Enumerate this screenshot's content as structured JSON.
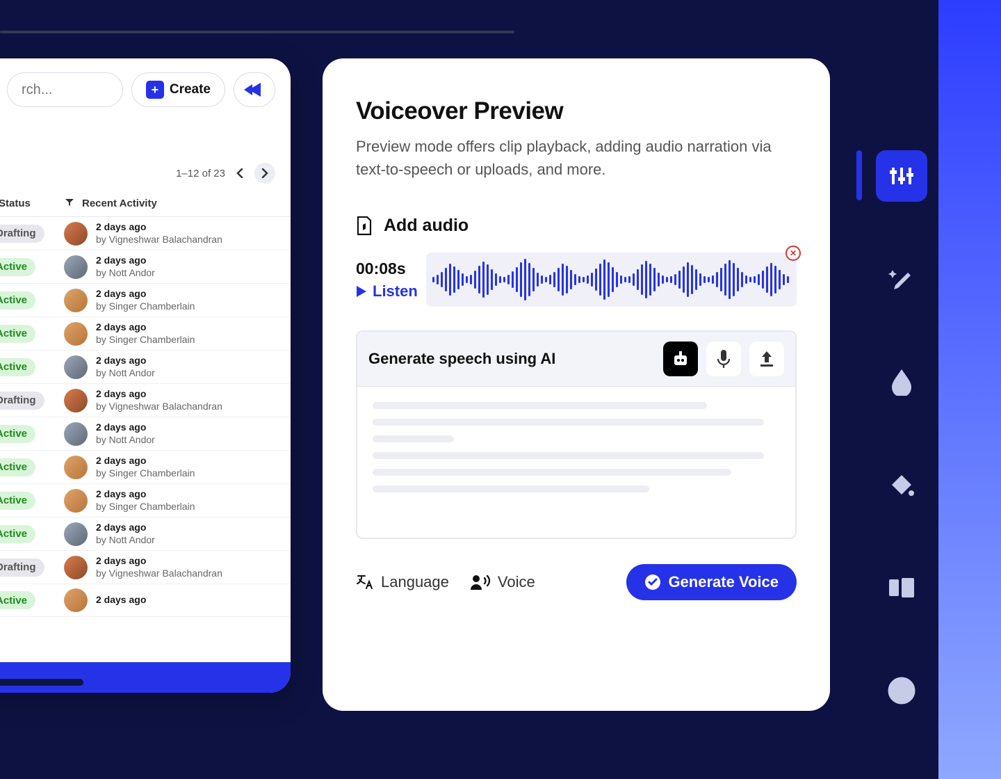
{
  "left": {
    "search_placeholder": "rch...",
    "create_label": "Create",
    "pager": "1–12 of 23",
    "columns": {
      "status": "Status",
      "activity": "Recent Activity"
    },
    "rows": [
      {
        "status": "Drafting",
        "when": "2 days ago",
        "by": "by Vigneshwar Balachandran",
        "av": "av1"
      },
      {
        "status": "Active",
        "when": "2 days ago",
        "by": "by Nott Andor",
        "av": "av2"
      },
      {
        "status": "Active",
        "when": "2 days ago",
        "by": "by Singer Chamberlain",
        "av": "av3"
      },
      {
        "status": "Active",
        "when": "2 days ago",
        "by": "by Singer Chamberlain",
        "av": "av3"
      },
      {
        "status": "Active",
        "when": "2 days ago",
        "by": "by Nott Andor",
        "av": "av2"
      },
      {
        "status": "Drafting",
        "when": "2 days ago",
        "by": "by Vigneshwar Balachandran",
        "av": "av1"
      },
      {
        "status": "Active",
        "when": "2 days ago",
        "by": "by Nott Andor",
        "av": "av2"
      },
      {
        "status": "Active",
        "when": "2 days ago",
        "by": "by Singer Chamberlain",
        "av": "av3"
      },
      {
        "status": "Active",
        "when": "2 days ago",
        "by": "by Singer Chamberlain",
        "av": "av3"
      },
      {
        "status": "Active",
        "when": "2 days ago",
        "by": "by Nott Andor",
        "av": "av2"
      },
      {
        "status": "Drafting",
        "when": "2 days ago",
        "by": "by Vigneshwar Balachandran",
        "av": "av1"
      },
      {
        "status": "Active",
        "when": "2 days ago",
        "by": "",
        "av": "av3"
      }
    ]
  },
  "vo": {
    "title": "Voiceover Preview",
    "desc": "Preview mode offers clip playback, adding audio narration via text-to-speech or uploads, and more.",
    "add_audio": "Add audio",
    "duration": "00:08s",
    "listen": "Listen",
    "gen_title": "Generate speech using AI",
    "language": "Language",
    "voice": "Voice",
    "generate_btn": "Generate Voice"
  }
}
